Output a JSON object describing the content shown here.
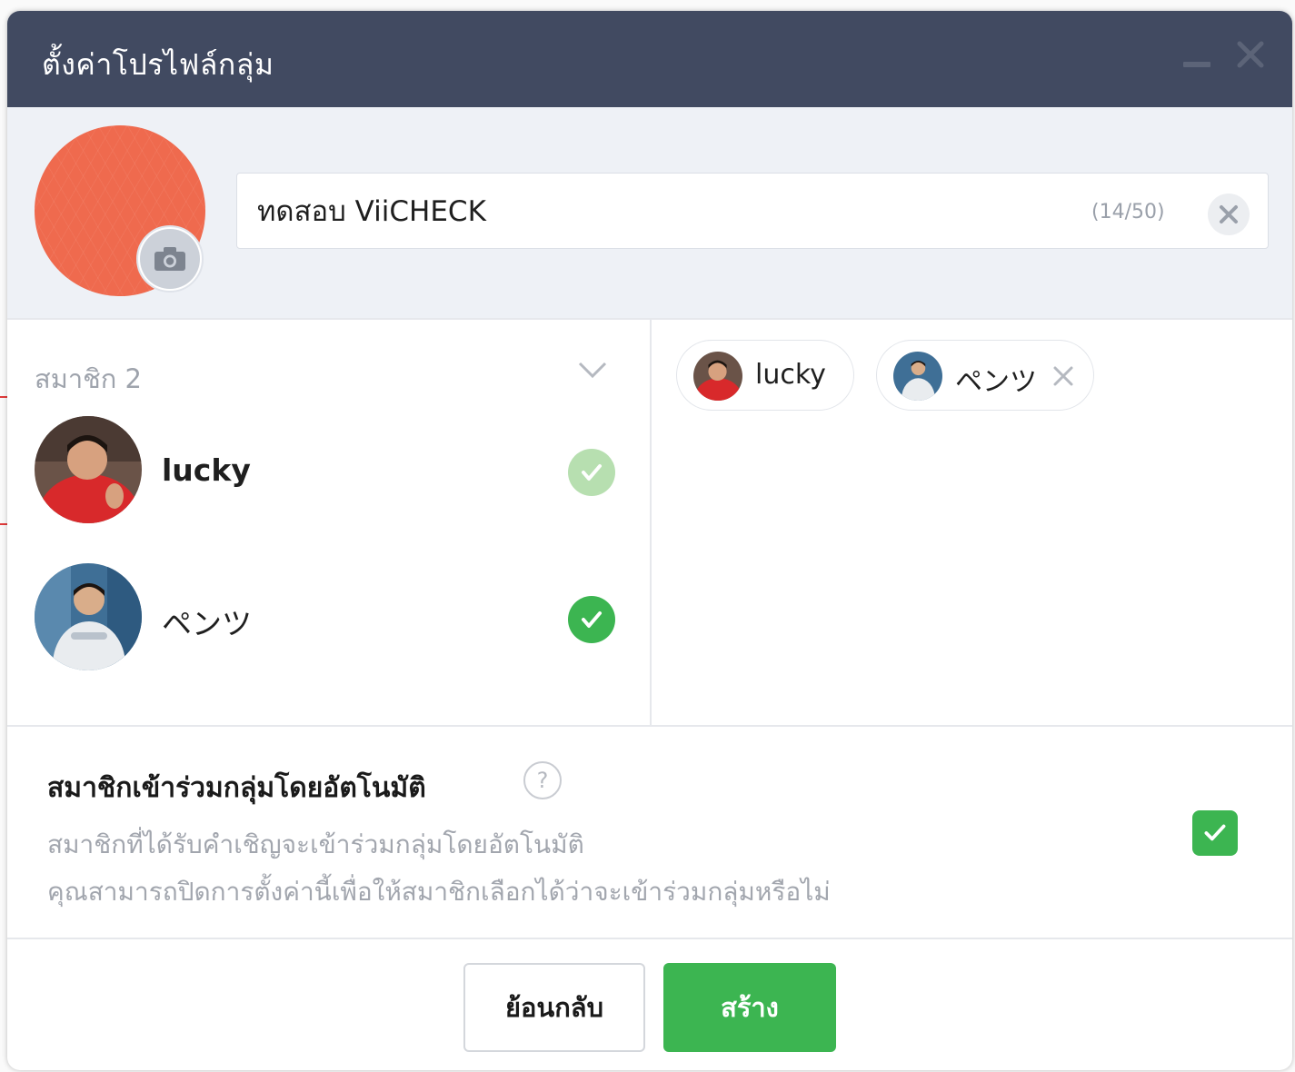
{
  "dialog": {
    "title": "ตั้งค่าโปรไฟล์กลุ่ม"
  },
  "profile": {
    "group_name": "ทดสอบ ViiCHECK",
    "char_counter": "(14/50)",
    "avatar_color": "#ef6a4e"
  },
  "members": {
    "header": "สมาชิก 2",
    "list": [
      {
        "name": "lucky",
        "selected": true,
        "check_color": "#b7dfb0"
      },
      {
        "name": "ペンツ",
        "selected": true,
        "check_color": "#3cb551"
      }
    ]
  },
  "selected_chips": [
    {
      "label": "lucky"
    },
    {
      "label": "ペンツ"
    }
  ],
  "auto_join": {
    "title": "สมาชิกเข้าร่วมกลุ่มโดยอัตโนมัติ",
    "help_symbol": "?",
    "description_line1": "สมาชิกที่ได้รับคำเชิญจะเข้าร่วมกลุ่มโดยอัตโนมัติ",
    "description_line2": "คุณสามารถปิดการตั้งค่านี้เพื่อให้สมาชิกเลือกได้ว่าจะเข้าร่วมกลุ่มหรือไม่",
    "enabled": true
  },
  "footer": {
    "back_label": "ย้อนกลับ",
    "create_label": "สร้าง"
  },
  "colors": {
    "titlebar": "#414a61",
    "accent_green": "#3cb551",
    "profile_bg": "#eef1f6"
  }
}
